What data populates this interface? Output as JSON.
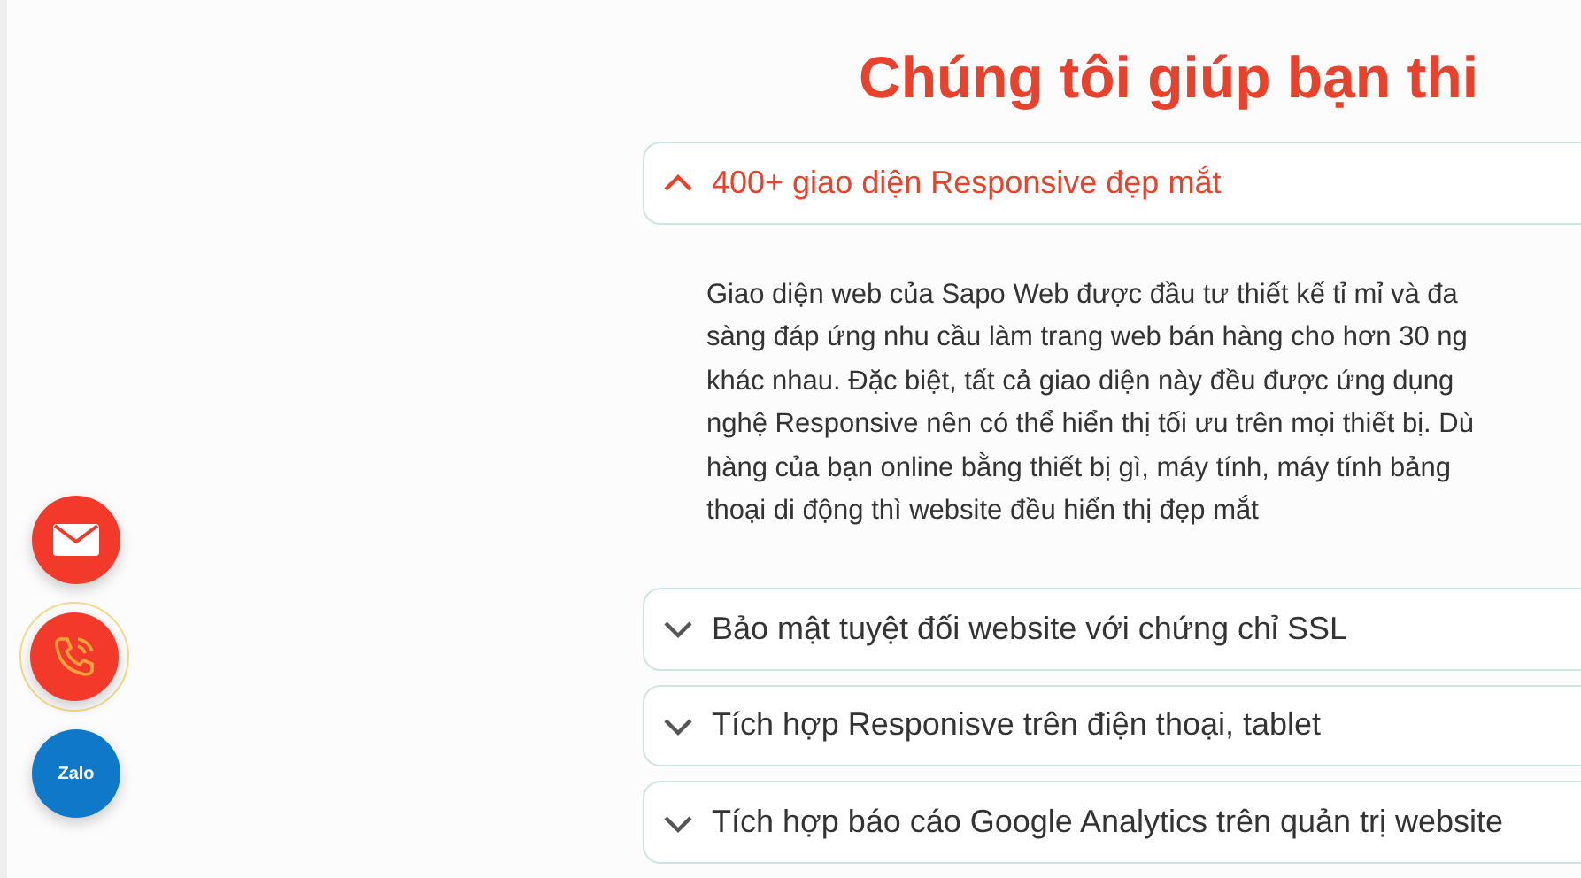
{
  "heading": "Chúng tôi giúp bạn thi",
  "faq": [
    {
      "title": "400+ giao diện Responsive đẹp mắt",
      "expanded": true,
      "body_lines": [
        "Giao diện web của Sapo Web được đầu tư thiết kế tỉ mỉ và đa",
        "sàng đáp ứng nhu cầu làm trang web bán hàng cho hơn 30 ng",
        "khác nhau. Đặc biệt, tất cả giao diện này đều được ứng dụng",
        "nghệ Responsive nên có thể hiển thị tối ưu trên mọi thiết bị. Dù",
        "hàng của bạn online bằng thiết bị gì, máy tính, máy tính bảng",
        "thoại di động thì website đều hiển thị đẹp mắt"
      ]
    },
    {
      "title": "Bảo mật tuyệt đối website với chứng chỉ SSL",
      "expanded": false
    },
    {
      "title": "Tích hợp Responisve trên điện thoại, tablet",
      "expanded": false
    },
    {
      "title": "Tích hợp báo cáo Google Analytics trên quản trị website",
      "expanded": false
    }
  ],
  "contact_buttons": [
    {
      "kind": "email"
    },
    {
      "kind": "phone"
    },
    {
      "kind": "zalo",
      "label": "Zalo"
    }
  ]
}
